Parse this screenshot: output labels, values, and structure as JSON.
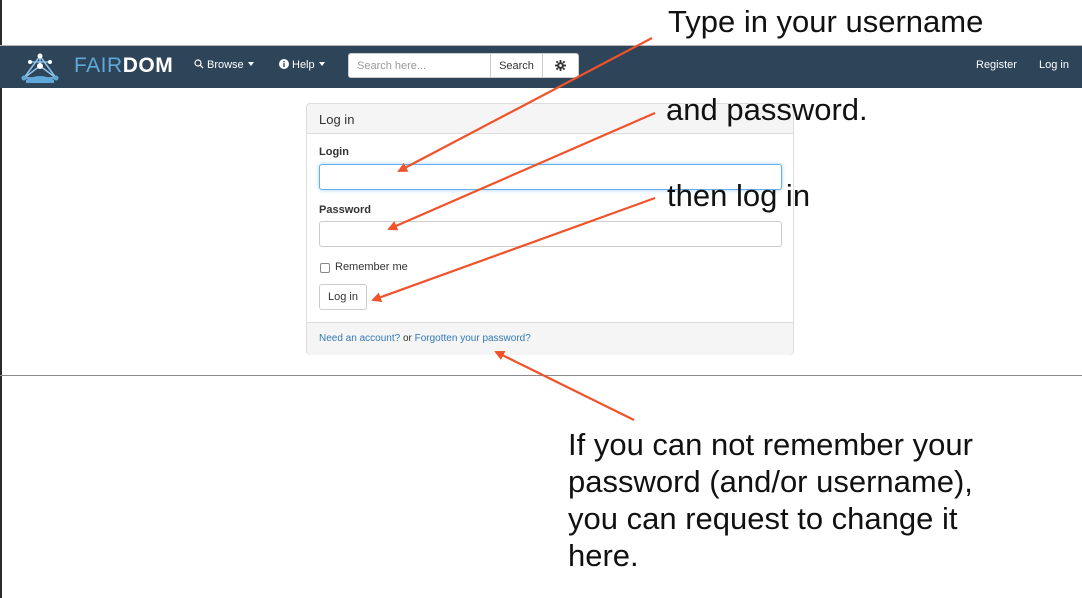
{
  "navbar": {
    "brand_part1": "FAIR",
    "brand_part2": "DOM",
    "browse_label": "Browse",
    "help_label": "Help",
    "search_placeholder": "Search here...",
    "search_button": "Search",
    "register_label": "Register",
    "login_label": "Log in",
    "background_color": "#2d4459",
    "icons": [
      "fairdom-logo-icon",
      "search-icon",
      "info-circle-icon",
      "gear-icon"
    ]
  },
  "login_panel": {
    "title": "Log in",
    "login_label": "Login",
    "login_value": "",
    "password_label": "Password",
    "password_value": "",
    "remember_label": "Remember me",
    "remember_checked": false,
    "submit_label": "Log in",
    "footer_link_account": "Need an account?",
    "footer_or": " or ",
    "footer_link_forgot": "Forgotten your password?"
  },
  "annotations": {
    "username": "Type in your username",
    "password": "and password.",
    "login": "then log in",
    "forgot_line1": "If you can not remember your",
    "forgot_line2": "password (and/or username),",
    "forgot_line3": "you can request to change it",
    "forgot_line4": "here.",
    "arrow_color": "#f0522a"
  }
}
